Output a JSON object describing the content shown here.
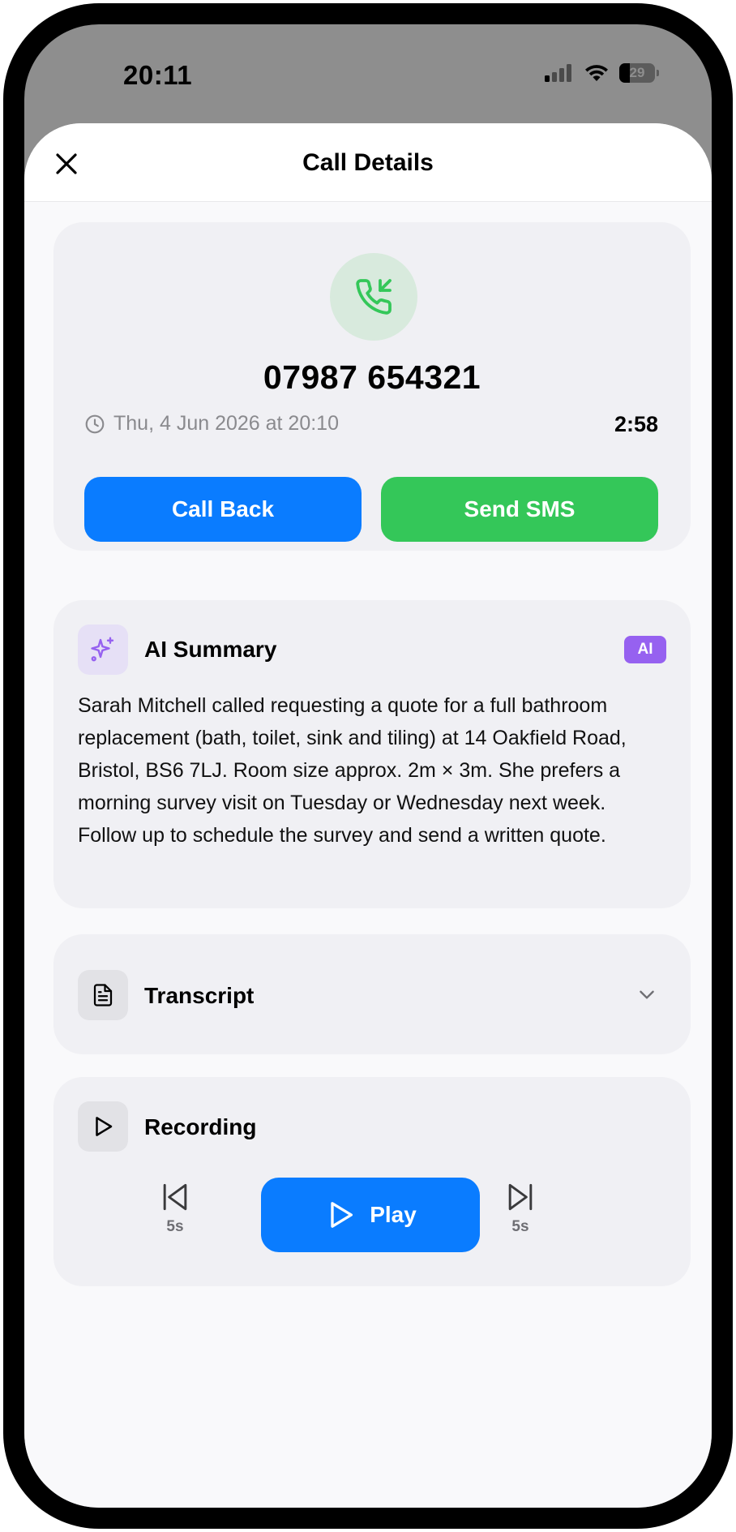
{
  "status_bar": {
    "time": "20:11",
    "battery": "29"
  },
  "header": {
    "title": "Call Details"
  },
  "call": {
    "number": "07987 654321",
    "datetime": "Thu, 4 Jun 2026 at 20:10",
    "duration": "2:58",
    "call_back_label": "Call Back",
    "send_sms_label": "Send SMS"
  },
  "ai_summary": {
    "title": "AI Summary",
    "badge": "AI",
    "text": "Sarah Mitchell called requesting a quote for a full bathroom replacement (bath, toilet, sink and tiling) at 14 Oakfield Road, Bristol, BS6 7LJ. Room size approx. 2m × 3m. She prefers a morning survey visit on Tuesday or Wednesday next week. Follow up to schedule the survey and send a written quote."
  },
  "transcript": {
    "title": "Transcript"
  },
  "recording": {
    "title": "Recording",
    "skip_back_label": "5s",
    "play_label": "Play",
    "skip_forward_label": "5s"
  },
  "colors": {
    "primary_blue": "#0a7cff",
    "sms_green": "#34c759",
    "ai_purple": "#9661f0",
    "incoming_green": "#34c759"
  },
  "icons": {
    "call_type": "phone-incoming-icon",
    "close": "close-icon",
    "clock": "clock-icon",
    "summary": "sparkles-icon",
    "transcript": "document-icon",
    "recording": "play-icon",
    "chevron": "chevron-down-icon"
  }
}
